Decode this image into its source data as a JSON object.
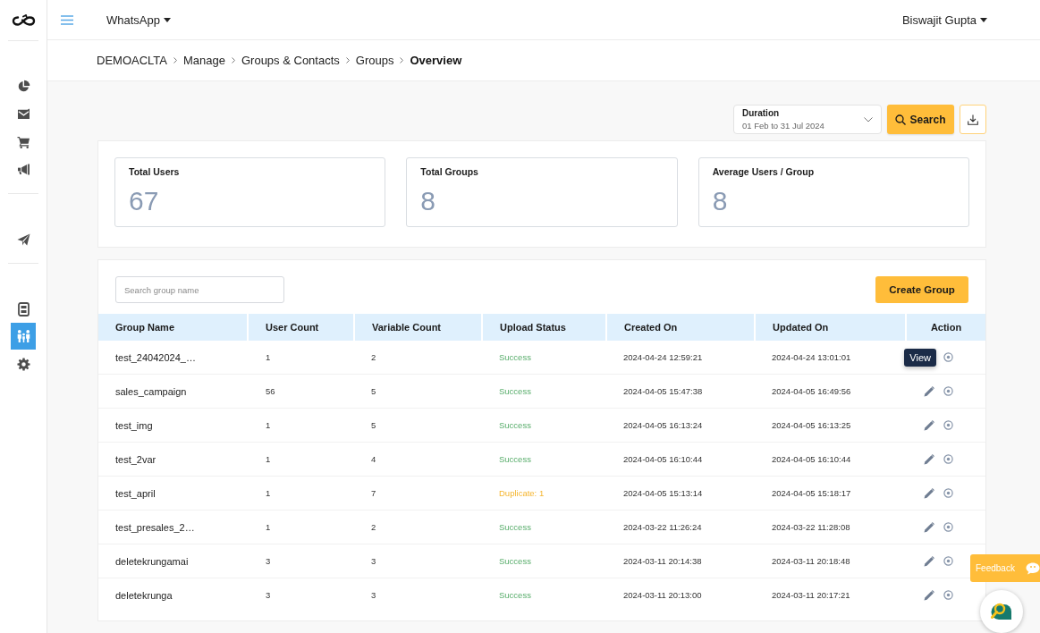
{
  "sidebar": {
    "groups": [
      {
        "items": [
          {
            "selected": false
          },
          {
            "selected": false
          },
          {
            "selected": false
          },
          {
            "selected": false
          }
        ]
      },
      {
        "items": [
          {
            "selected": false
          }
        ]
      },
      {
        "items": [
          {
            "selected": false
          },
          {
            "selected": true
          },
          {
            "selected": false
          }
        ]
      }
    ]
  },
  "topbar": {
    "channel": "WhatsApp",
    "user": "Biswajit Gupta"
  },
  "breadcrumb": [
    {
      "label": "DEMOACLTA",
      "current": false
    },
    {
      "label": "Manage",
      "current": false
    },
    {
      "label": "Groups & Contacts",
      "current": false
    },
    {
      "label": "Groups",
      "current": false
    },
    {
      "label": "Overview",
      "current": true
    }
  ],
  "filters": {
    "duration": {
      "label": "Duration",
      "value": "01 Feb to 31 Jul 2024"
    },
    "search_button": "Search"
  },
  "stats": [
    {
      "label": "Total Users",
      "value": "67"
    },
    {
      "label": "Total Groups",
      "value": "8"
    },
    {
      "label": "Average Users / Group",
      "value": "8"
    }
  ],
  "groups_table": {
    "search": {
      "placeholder": "Search group name"
    },
    "create_button": "Create Group",
    "columns": [
      "Group Name",
      "User Count",
      "Variable Count",
      "Upload Status",
      "Created On",
      "Updated On",
      "Action"
    ],
    "rows": [
      {
        "group_name": "test_24042024_…",
        "user_count": "1",
        "variable_count": "2",
        "upload_status": {
          "text": "Success",
          "kind": "success"
        },
        "created_on": "2024-04-24 12:59:21",
        "updated_on": "2024-04-24 13:01:01",
        "tooltip": "View"
      },
      {
        "group_name": "sales_campaign",
        "user_count": "56",
        "variable_count": "5",
        "upload_status": {
          "text": "Success",
          "kind": "success"
        },
        "created_on": "2024-04-05 15:47:38",
        "updated_on": "2024-04-05 16:49:56"
      },
      {
        "group_name": "test_img",
        "user_count": "1",
        "variable_count": "5",
        "upload_status": {
          "text": "Success",
          "kind": "success"
        },
        "created_on": "2024-04-05 16:13:24",
        "updated_on": "2024-04-05 16:13:25"
      },
      {
        "group_name": "test_2var",
        "user_count": "1",
        "variable_count": "4",
        "upload_status": {
          "text": "Success",
          "kind": "success"
        },
        "created_on": "2024-04-05 16:10:44",
        "updated_on": "2024-04-05 16:10:44"
      },
      {
        "group_name": "test_april",
        "user_count": "1",
        "variable_count": "7",
        "upload_status": {
          "text": "Duplicate: 1",
          "kind": "duplicate"
        },
        "created_on": "2024-04-05 15:13:14",
        "updated_on": "2024-04-05 15:18:17"
      },
      {
        "group_name": "test_presales_2…",
        "user_count": "1",
        "variable_count": "2",
        "upload_status": {
          "text": "Success",
          "kind": "success"
        },
        "created_on": "2024-03-22 11:26:24",
        "updated_on": "2024-03-22 11:28:08"
      },
      {
        "group_name": "deletekrungamai",
        "user_count": "3",
        "variable_count": "3",
        "upload_status": {
          "text": "Success",
          "kind": "success"
        },
        "created_on": "2024-03-11 20:14:38",
        "updated_on": "2024-03-11 20:18:48"
      },
      {
        "group_name": "deletekrunga",
        "user_count": "3",
        "variable_count": "3",
        "upload_status": {
          "text": "Success",
          "kind": "success"
        },
        "created_on": "2024-03-11 20:13:00",
        "updated_on": "2024-03-11 20:17:21"
      }
    ]
  },
  "feedback": {
    "label": "Feedback"
  }
}
